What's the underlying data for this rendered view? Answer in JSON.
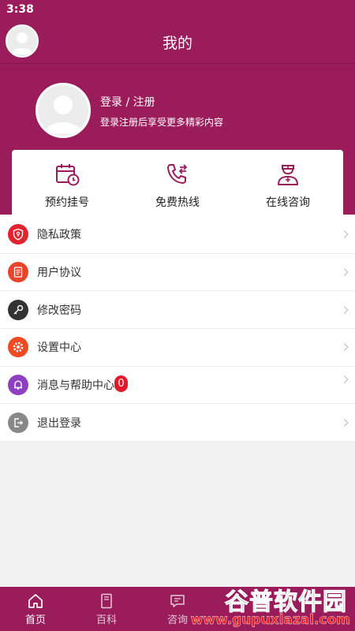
{
  "status": {
    "time": "3:38"
  },
  "header": {
    "title": "我的"
  },
  "profile": {
    "login_label": "登录 / 注册",
    "subtitle": "登录注册后享受更多精彩内容"
  },
  "quick_actions": [
    {
      "label": "预约挂号",
      "icon": "calendar-clock-icon"
    },
    {
      "label": "免费热线",
      "icon": "phone-icon"
    },
    {
      "label": "在线咨询",
      "icon": "doctor-icon"
    }
  ],
  "menu": [
    {
      "label": "隐私政策",
      "icon": "shield-icon",
      "color": "#e2222e"
    },
    {
      "label": "用户协议",
      "icon": "document-icon",
      "color": "#e8442b"
    },
    {
      "label": "修改密码",
      "icon": "key-icon",
      "color": "#333333"
    },
    {
      "label": "设置中心",
      "icon": "gear-icon",
      "color": "#ef4a22"
    },
    {
      "label": "消息与帮助中心",
      "icon": "bell-icon",
      "color": "#8e3fc2",
      "badge": "0"
    },
    {
      "label": "退出登录",
      "icon": "logout-icon",
      "color": "#888888"
    }
  ],
  "bottom_nav": [
    {
      "label": "首页",
      "icon": "home-icon"
    },
    {
      "label": "百科",
      "icon": "book-icon"
    },
    {
      "label": "咨询",
      "icon": "chat-icon"
    }
  ],
  "watermark": {
    "title": "谷普软件园",
    "url": "www.gupuxlazal.com"
  },
  "colors": {
    "brand": "#9a1c5b",
    "badge": "#e2182b"
  }
}
